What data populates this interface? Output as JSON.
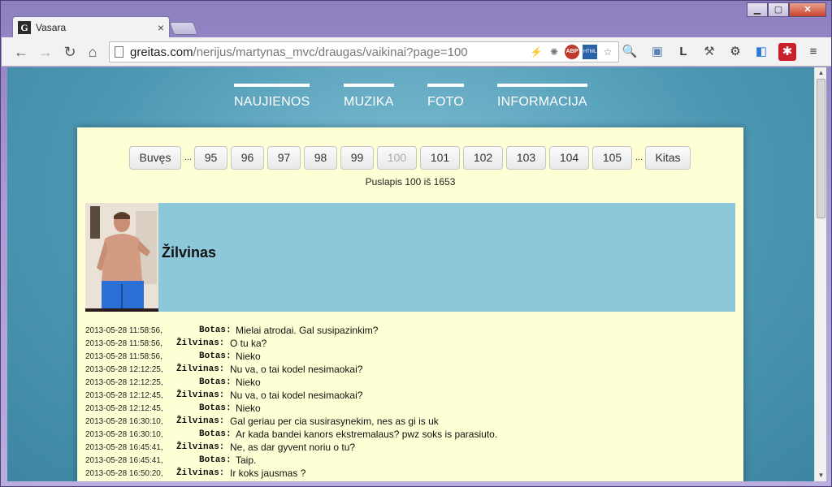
{
  "browser": {
    "tab_title": "Vasara",
    "favicon": "G",
    "url_host": "greitas.com",
    "url_path": "/nerijus/martynas_mvc/draugas/vaikinai?page=100"
  },
  "menu": [
    "NAUJIENOS",
    "MUZIKA",
    "FOTO",
    "INFORMACIJA"
  ],
  "pager": {
    "prev": "Buvęs",
    "next": "Kitas",
    "ellipsis": "...",
    "pages": [
      "95",
      "96",
      "97",
      "98",
      "99",
      "100",
      "101",
      "102",
      "103",
      "104",
      "105"
    ],
    "current": "100",
    "info": "Puslapis 100 iš 1653"
  },
  "profile": {
    "name": "Žilvinas"
  },
  "chat": [
    {
      "ts": "2013-05-28 11:58:56,",
      "who": "Botas:",
      "msg": "Mielai atrodai. Gal susipazinkim?"
    },
    {
      "ts": "2013-05-28 11:58:56,",
      "who": "Žilvinas:",
      "msg": "O tu ka?"
    },
    {
      "ts": "2013-05-28 11:58:56,",
      "who": "Botas:",
      "msg": "Nieko"
    },
    {
      "ts": "2013-05-28 12:12:25,",
      "who": "Žilvinas:",
      "msg": "Nu va, o tai kodel nesimaokai?"
    },
    {
      "ts": "2013-05-28 12:12:25,",
      "who": "Botas:",
      "msg": "Nieko"
    },
    {
      "ts": "2013-05-28 12:12:45,",
      "who": "Žilvinas:",
      "msg": "Nu va, o tai kodel nesimaokai?"
    },
    {
      "ts": "2013-05-28 12:12:45,",
      "who": "Botas:",
      "msg": "Nieko"
    },
    {
      "ts": "2013-05-28 16:30:10,",
      "who": "Žilvinas:",
      "msg": "Gal geriau per cia susirasynekim, nes as gi is uk"
    },
    {
      "ts": "2013-05-28 16:30:10,",
      "who": "Botas:",
      "msg": "Ar kada bandei kanors ekstremalaus? pwz soks is parasiuto."
    },
    {
      "ts": "2013-05-28 16:45:41,",
      "who": "Žilvinas:",
      "msg": "Ne, as dar gyvent noriu o tu?"
    },
    {
      "ts": "2013-05-28 16:45:41,",
      "who": "Botas:",
      "msg": "Taip."
    },
    {
      "ts": "2013-05-28 16:50:20,",
      "who": "Žilvinas:",
      "msg": "Ir koks jausmas ?"
    }
  ]
}
